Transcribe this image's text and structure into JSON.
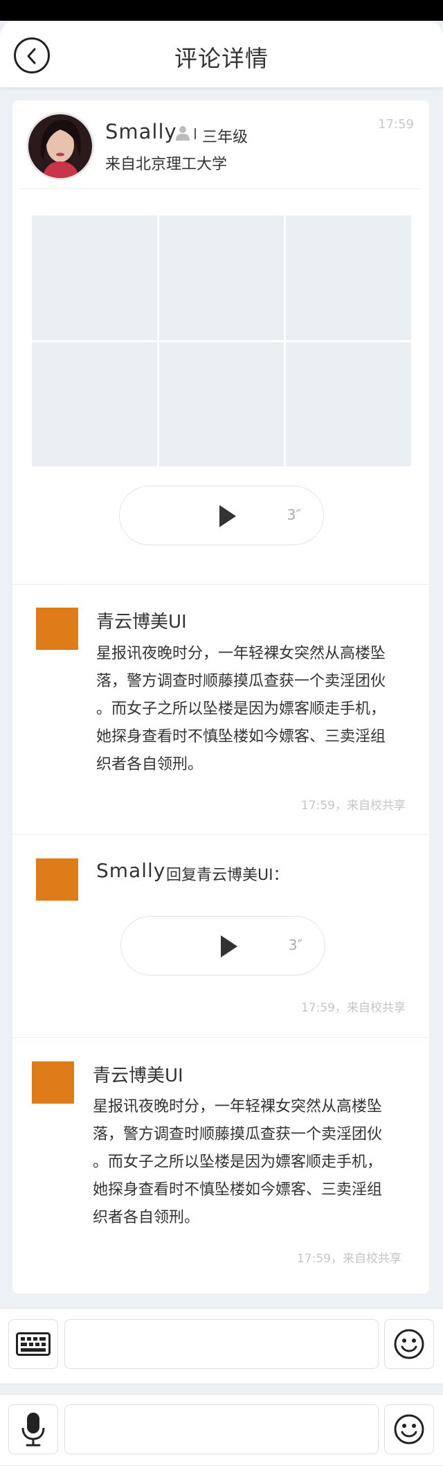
{
  "header": {
    "title": "评论详情"
  },
  "post": {
    "user_name": "Smally",
    "grade": "三年级",
    "school": "来自北京理工大学",
    "time": "17:59",
    "voice_duration": "3″"
  },
  "comments": [
    {
      "name": "青云博美UI",
      "lines": [
        "星报讯夜晚时分，一年轻裸女突然从高楼坠",
        "落，警方调查时顺藤摸瓜查获一个卖淫团伙",
        "。而女子之所以坠楼是因为嫖客顺走手机，",
        "她探身查看时不慎坠楼如今嫖客、三卖淫组",
        "织者各自领刑。"
      ],
      "meta": "17:59，来自校共享"
    },
    {
      "name": "Smally",
      "reply_to": "回复青云博美UI：",
      "voice_duration": "3″",
      "meta": "17:59，来自校共享"
    },
    {
      "name": "青云博美UI",
      "lines": [
        "星报讯夜晚时分，一年轻裸女突然从高楼坠",
        "落，警方调查时顺藤摸瓜查获一个卖淫团伙",
        "。而女子之所以坠楼是因为嫖客顺走手机，",
        "她探身查看时不慎坠楼如今嫖客、三卖淫组",
        "织者各自领刑。"
      ],
      "meta": "17:59，来自校共享"
    }
  ],
  "input_bars": [
    {
      "left_icon": "keyboard-icon",
      "right_icon": "smiley-icon",
      "value": ""
    },
    {
      "left_icon": "microphone-icon",
      "right_icon": "smiley-icon",
      "value": ""
    }
  ],
  "colors": {
    "comment_avatar": "#df7c1a",
    "background": "#edf0f4",
    "image_placeholder": "#ebeef3"
  }
}
